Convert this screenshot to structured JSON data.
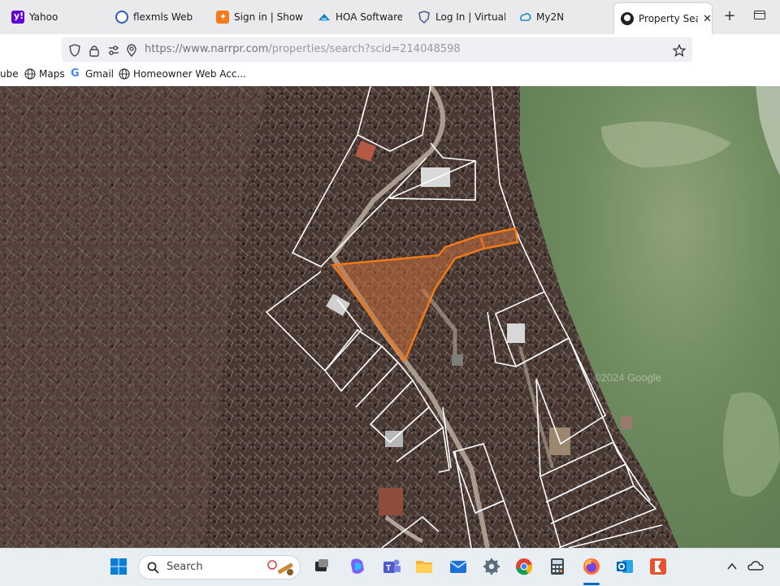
{
  "browser": {
    "tabs": [
      {
        "label": "Yahoo",
        "icon": "yahoo-icon",
        "color": "#6001d2"
      },
      {
        "label": "flexmls Web",
        "icon": "flexmls-icon",
        "color": "#2a5db0"
      },
      {
        "label": "Sign in | Showing",
        "icon": "showingtime-icon",
        "color": "#f47a20"
      },
      {
        "label": "HOA Software | H",
        "icon": "hoa-icon",
        "color": "#1f7ac0"
      },
      {
        "label": "Log In | Virtual Ke",
        "icon": "shield-icon",
        "color": "#4a5a8a"
      },
      {
        "label": "My2N",
        "icon": "my2n-icon",
        "color": "#1a8fb8"
      },
      {
        "label": "Property Searc",
        "icon": "narrpr-icon",
        "color": "#222222",
        "active": true
      }
    ],
    "new_tab_label": "+",
    "close_label": "✕",
    "url_host": "https://www.narrpr.com",
    "url_path": "/properties/search?scid=214048598",
    "bookmarks": [
      {
        "label": "ube",
        "icon": "youtube-icon"
      },
      {
        "label": "Maps",
        "icon": "globe-icon"
      },
      {
        "label": "Gmail",
        "icon": "google-icon"
      },
      {
        "label": "Homeowner Web Acc...",
        "icon": "globe-icon"
      }
    ]
  },
  "map": {
    "watermark": "©2024 Google",
    "highlight_color": "#f07a1a"
  },
  "taskbar": {
    "search_placeholder": "Search",
    "apps": [
      "windows-start-icon",
      "search-icon",
      "task-view-icon",
      "copilot-icon",
      "teams-icon",
      "file-explorer-icon",
      "mail-icon",
      "settings-icon",
      "chrome-icon",
      "calculator-icon",
      "firefox-icon",
      "outlook-icon",
      "office-icon"
    ],
    "tray": [
      "chevron-up-icon",
      "onedrive-icon"
    ]
  }
}
